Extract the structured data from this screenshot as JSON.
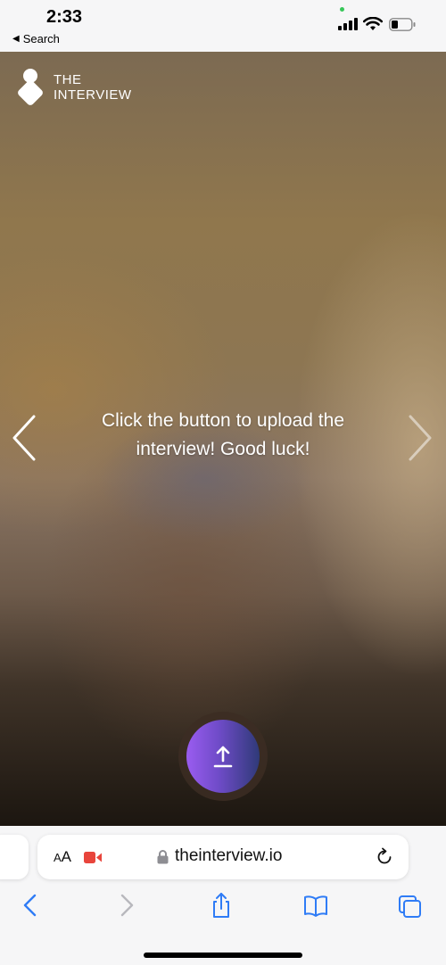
{
  "status_bar": {
    "time": "2:33",
    "back_label": "Search",
    "icons": [
      "signal-icon",
      "wifi-icon",
      "battery-icon"
    ],
    "recording_dot_color": "#37c759"
  },
  "app": {
    "logo_line1": "THE",
    "logo_line2": "INTERVIEW",
    "message": "Click the button to upload the interview! Good luck!",
    "upload_button_icon": "upload-arrow-icon",
    "accent_gradient": [
      "#9a5cf0",
      "#2f3a78"
    ]
  },
  "browser": {
    "aa_label_small": "A",
    "aa_label_large": "A",
    "url": "theinterview.io",
    "camera_indicator_color": "#e8453c",
    "toolbar": [
      "back-icon",
      "forward-icon",
      "share-icon",
      "bookmarks-icon",
      "tabs-icon"
    ]
  }
}
